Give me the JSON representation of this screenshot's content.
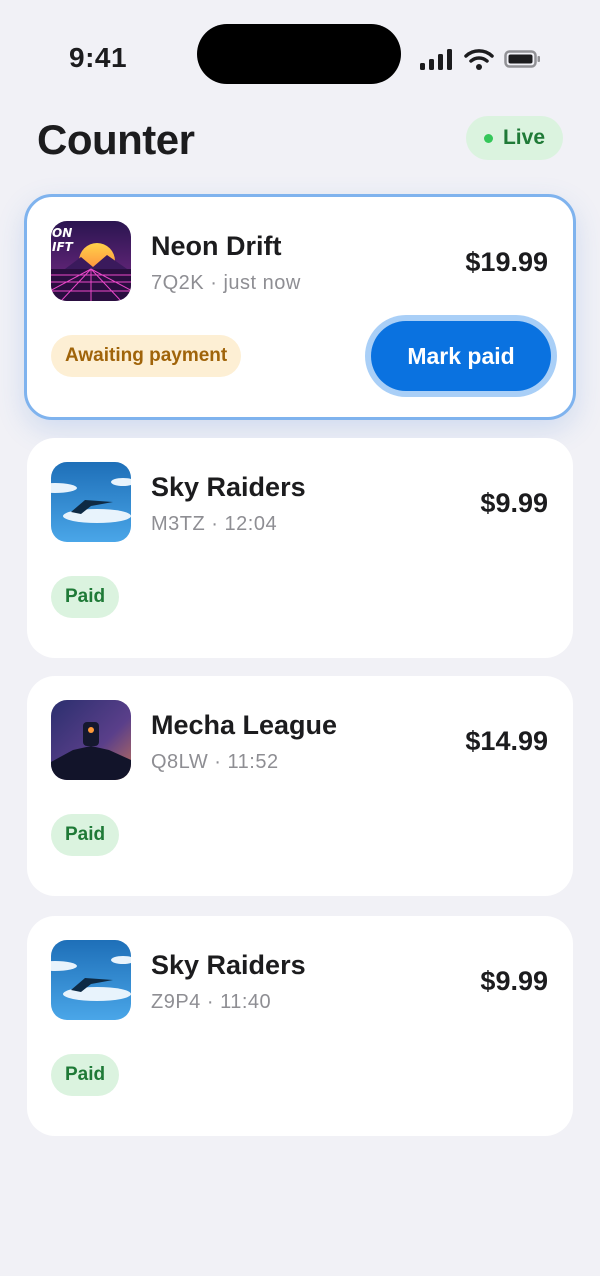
{
  "status_bar": {
    "time": "9:41"
  },
  "header": {
    "title": "Counter",
    "live_label": "Live"
  },
  "orders": [
    {
      "game": "Neon Drift",
      "code": "7Q2K",
      "time": "just now",
      "price": "$19.99",
      "status": "Awaiting payment",
      "action": "Mark paid",
      "thumb_text": [
        "ON",
        "IFT"
      ]
    },
    {
      "game": "Sky Raiders",
      "code": "M3TZ",
      "time": "12:04",
      "price": "$9.99",
      "status": "Paid"
    },
    {
      "game": "Mecha League",
      "code": "Q8LW",
      "time": "11:52",
      "price": "$14.99",
      "status": "Paid"
    },
    {
      "game": "Sky Raiders",
      "code": "Z9P4",
      "time": "11:40",
      "price": "$9.99",
      "status": "Paid"
    }
  ],
  "separator": "·",
  "colors": {
    "accent": "#0a72e0",
    "paid": "#1f7a37",
    "awaiting": "#a0640a",
    "live_dot": "#34c759"
  }
}
